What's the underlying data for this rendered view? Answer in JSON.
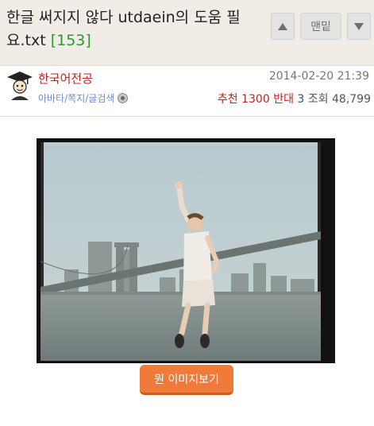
{
  "post": {
    "title": "한글 써지지 않다 utdaein의 도움 필요.txt",
    "comment_count": "[153]"
  },
  "nav": {
    "bottom_label": "맨밑",
    "up_icon": "triangle-up-icon",
    "down_icon": "triangle-down-icon"
  },
  "author": {
    "name": "한국어전공",
    "links": "아바타/쪽지/글검색",
    "avatar_icon": "graduate-avatar-icon",
    "badge_icon": "level-badge-icon"
  },
  "stats": {
    "datetime": "2014-02-20 21:39",
    "recommend_label": "추천",
    "recommend_value": "1300",
    "oppose_label": "반대",
    "oppose_value": "3",
    "views_label": "조회",
    "views_value": "48,799"
  },
  "content": {
    "original_image_button": "원 이미지보기"
  },
  "colors": {
    "header_bg": "#f2ece6",
    "author_red": "#c81e1e",
    "count_green": "#2c9a2c",
    "oppose_blue": "#2b47a8",
    "link_blue": "#6f8fc4",
    "button_orange": "#ef7a3a"
  }
}
